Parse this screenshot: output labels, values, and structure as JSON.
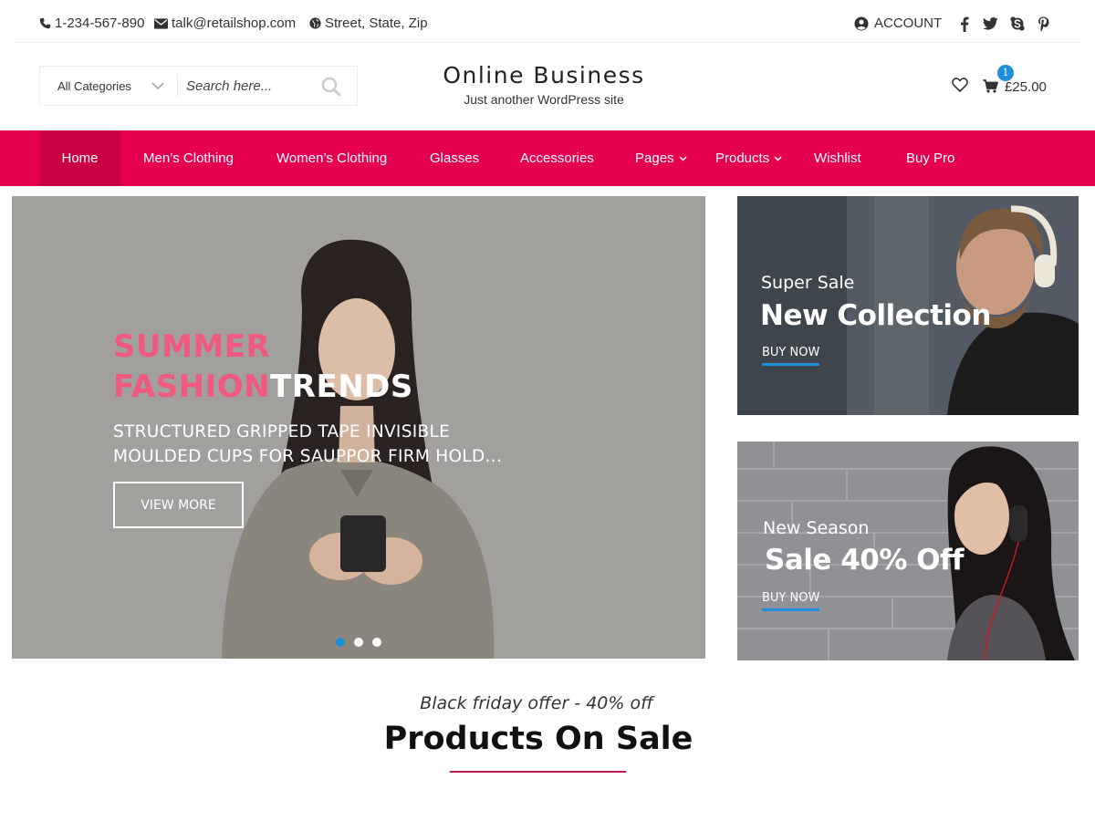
{
  "topbar": {
    "phone": "1-234-567-890",
    "email": "talk@retailshop.com",
    "address": "Street, State, Zip",
    "account_label": "ACCOUNT",
    "social_icons": [
      "facebook-icon",
      "twitter-icon",
      "skype-icon",
      "pinterest-icon"
    ]
  },
  "header": {
    "category_select": "All Categories",
    "search_placeholder": "Search here...",
    "site_title": "Online Business",
    "tagline": "Just another WordPress site",
    "cart_count": "1",
    "cart_total": "£25.00"
  },
  "nav": {
    "items": [
      {
        "label": "Home"
      },
      {
        "label": "Men’s Clothing"
      },
      {
        "label": "Women’s Clothing"
      },
      {
        "label": "Glasses"
      },
      {
        "label": "Accessories"
      },
      {
        "label": "Pages"
      },
      {
        "label": "Products"
      },
      {
        "label": "Wishlist"
      },
      {
        "label": "Buy Pro"
      }
    ]
  },
  "hero": {
    "title_line1": "SUMMER",
    "title_line2_accent": "FASHION",
    "title_line2_rest": "TRENDS",
    "subtitle_line1": "STRUCTURED GRIPPED TAPE INVISIBLE",
    "subtitle_line2": "MOULDED CUPS FOR SAUPPOR FIRM HOLD...",
    "button_label": "VIEW MORE",
    "slide_count": 3,
    "active_slide": 1
  },
  "banners": [
    {
      "small": "Super Sale",
      "big": "New Collection",
      "link": "BUY NOW"
    },
    {
      "small": "New Season",
      "big": "Sale 40% Off",
      "link": "BUY NOW"
    }
  ],
  "section": {
    "offer": "Black friday offer - 40% off",
    "title": "Products On Sale"
  },
  "colors": {
    "brand_pink": "#e5004f",
    "nav_active": "#c80043",
    "accent_blue": "#1e8fd8",
    "hero_pink_text": "#f05a7e"
  }
}
